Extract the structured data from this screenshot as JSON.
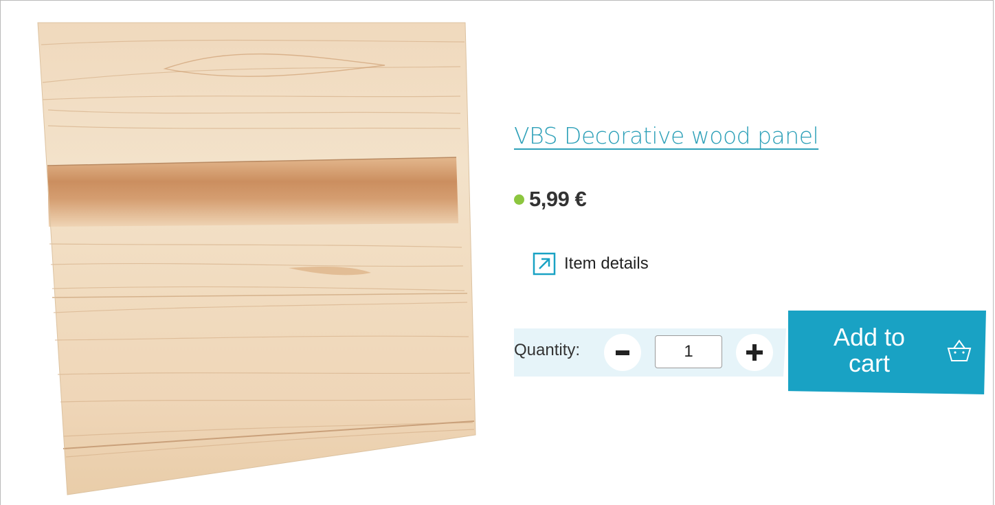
{
  "product": {
    "title": "VBS Decorative wood panel",
    "price": "5,99 €",
    "availability_color": "#8cc63f",
    "image_icon": "wood-panel-image"
  },
  "details": {
    "label": "Item details",
    "icon": "external-link-icon"
  },
  "quantity": {
    "label": "Quantity:",
    "value": "1",
    "decrease_icon": "minus-icon",
    "increase_icon": "plus-icon"
  },
  "cart": {
    "label": "Add to cart",
    "icon": "basket-icon"
  },
  "colors": {
    "accent": "#19a2c4",
    "link": "#2da0b8",
    "quantity_background": "#e6f4f9"
  }
}
